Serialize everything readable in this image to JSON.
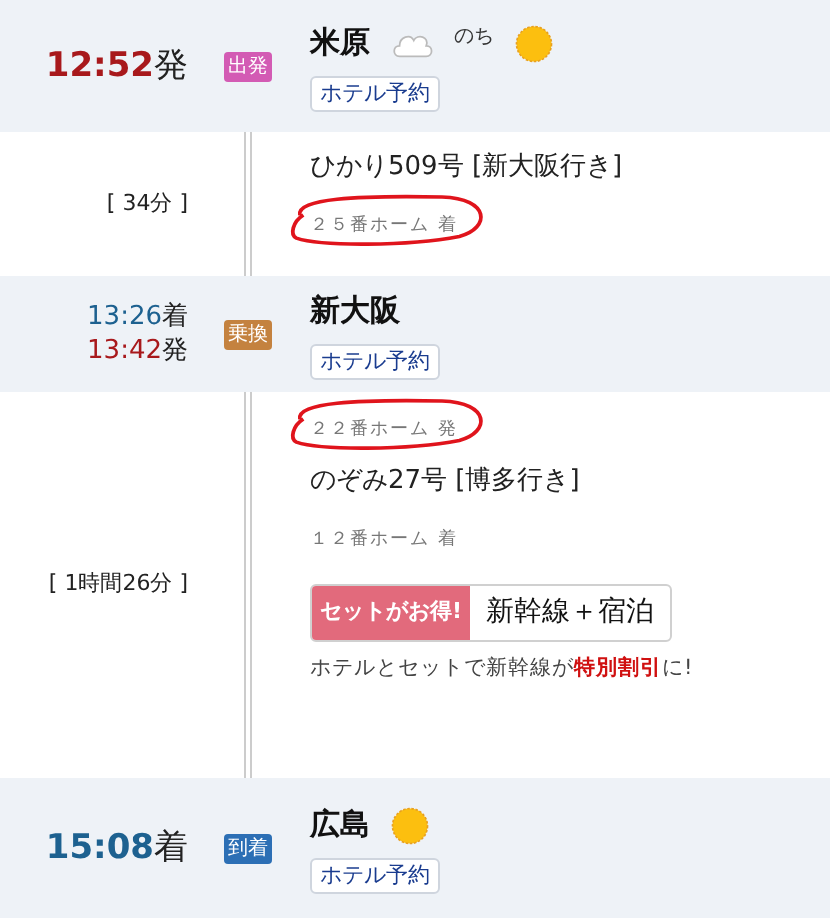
{
  "itinerary": [
    {
      "kind": "station",
      "times": [
        {
          "time": "12:52",
          "suffix": "発",
          "kind": "depart"
        }
      ],
      "big": true,
      "badge": {
        "text": "出発",
        "kind": "depart"
      },
      "name": "米原",
      "weather": [
        {
          "kind": "cloud"
        },
        {
          "kind": "text",
          "text": "のち"
        },
        {
          "kind": "sun"
        }
      ],
      "hotel_button": "ホテル予約"
    },
    {
      "kind": "segment",
      "duration": "[ 34分 ]",
      "lines": [
        {
          "kind": "train",
          "text": "ひかり509号 [新大阪行き]"
        },
        {
          "kind": "platform",
          "text": "２５番ホーム 着",
          "circled": true
        }
      ]
    },
    {
      "kind": "station",
      "times": [
        {
          "time": "13:26",
          "suffix": "着",
          "kind": "arrive"
        },
        {
          "time": "13:42",
          "suffix": "発",
          "kind": "depart"
        }
      ],
      "big": false,
      "badge": {
        "text": "乗換",
        "kind": "transfer"
      },
      "name": "新大阪",
      "hotel_button": "ホテル予約"
    },
    {
      "kind": "segment",
      "duration": "[ 1時間26分 ]",
      "lines": [
        {
          "kind": "platform",
          "text": "２２番ホーム 発",
          "circled": true
        },
        {
          "kind": "train",
          "text": "のぞみ27号 [博多行き]"
        },
        {
          "kind": "platform",
          "text": "１２番ホーム 着",
          "circled": false
        }
      ],
      "promo": {
        "tag": "セットがお得!",
        "label": "新幹線＋宿泊",
        "note": "ホテルとセットで新幹線が**特別割引**に!"
      }
    },
    {
      "kind": "station",
      "times": [
        {
          "time": "15:08",
          "suffix": "着",
          "kind": "arrive"
        }
      ],
      "big": true,
      "badge": {
        "text": "到着",
        "kind": "arrive"
      },
      "name": "広島",
      "weather": [
        {
          "kind": "sun"
        }
      ],
      "hotel_button": "ホテル予約"
    }
  ]
}
